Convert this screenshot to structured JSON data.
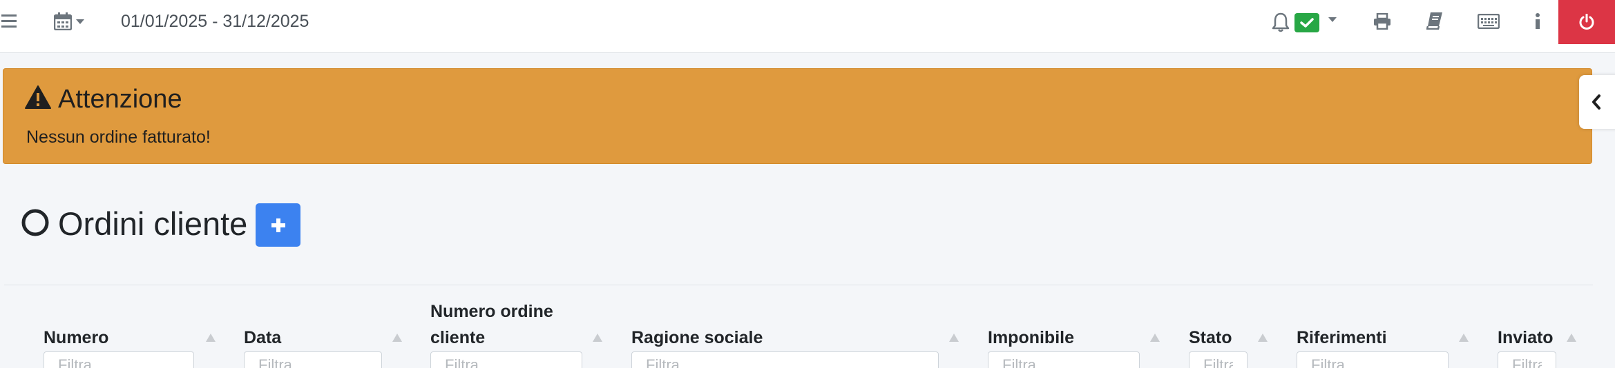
{
  "header": {
    "date_range": "01/01/2025 - 31/12/2025",
    "icons": [
      "menu-icon",
      "calendar-icon",
      "bell-icon",
      "check-icon",
      "print-icon",
      "book-icon",
      "keyboard-icon",
      "info-icon",
      "power-icon"
    ],
    "colors": {
      "notification_badge": "#28a745",
      "logout": "#dc3545"
    }
  },
  "alert": {
    "title": "Attenzione",
    "message": "Nessun ordine fatturato!",
    "color": "#df9a3e"
  },
  "page": {
    "title": "Ordini cliente",
    "add_icon": "plus-icon",
    "add_button_color": "#3c82f0"
  },
  "table": {
    "columns": [
      {
        "label": "Numero",
        "filter_placeholder": "Filtra..."
      },
      {
        "label": "Data",
        "filter_placeholder": "Filtra..."
      },
      {
        "label_line1": "Numero ordine",
        "label_line2": "cliente",
        "filter_placeholder": "Filtra..."
      },
      {
        "label": "Ragione sociale",
        "filter_placeholder": "Filtra..."
      },
      {
        "label": "Imponibile",
        "filter_placeholder": "Filtra..."
      },
      {
        "label": "Stato",
        "filter_placeholder": "Filtra..."
      },
      {
        "label": "Riferimenti",
        "filter_placeholder": "Filtra..."
      },
      {
        "label": "Inviato",
        "filter_placeholder": "Filtra..."
      }
    ]
  }
}
